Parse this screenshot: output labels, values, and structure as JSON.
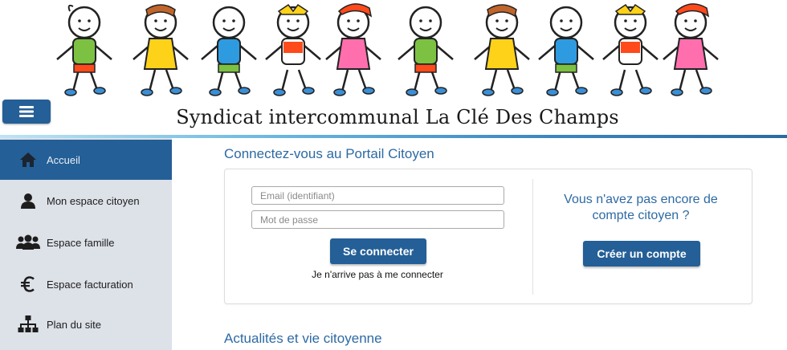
{
  "banner": {
    "title": "Syndicat intercommunal La Clé Des Champs",
    "illustration": "children-holding-hands-illustration"
  },
  "menu_toggle": {
    "icon": "hamburger-menu-icon"
  },
  "sidebar": {
    "items": [
      {
        "label": "Accueil",
        "icon": "home-icon",
        "active": true
      },
      {
        "label": "Mon espace citoyen",
        "icon": "user-icon",
        "active": false
      },
      {
        "label": "Espace famille",
        "icon": "family-icon",
        "active": false
      },
      {
        "label": "Espace facturation",
        "icon": "euro-icon",
        "active": false
      },
      {
        "label": "Plan du site",
        "icon": "sitemap-icon",
        "active": false
      }
    ]
  },
  "login": {
    "heading": "Connectez-vous au Portail Citoyen",
    "email_placeholder": "Email (identifiant)",
    "password_placeholder": "Mot de passe",
    "submit_label": "Se connecter",
    "forgot_link": "Je n'arrive pas à me connecter"
  },
  "signup": {
    "question": "Vous n'avez pas encore de compte citoyen ?",
    "button_label": "Créer un compte"
  },
  "news": {
    "heading": "Actualités et vie citoyenne"
  },
  "colors": {
    "primary": "#245f97",
    "heading_blue": "#2d6aa3",
    "sidebar_bg": "#dde1e8"
  }
}
